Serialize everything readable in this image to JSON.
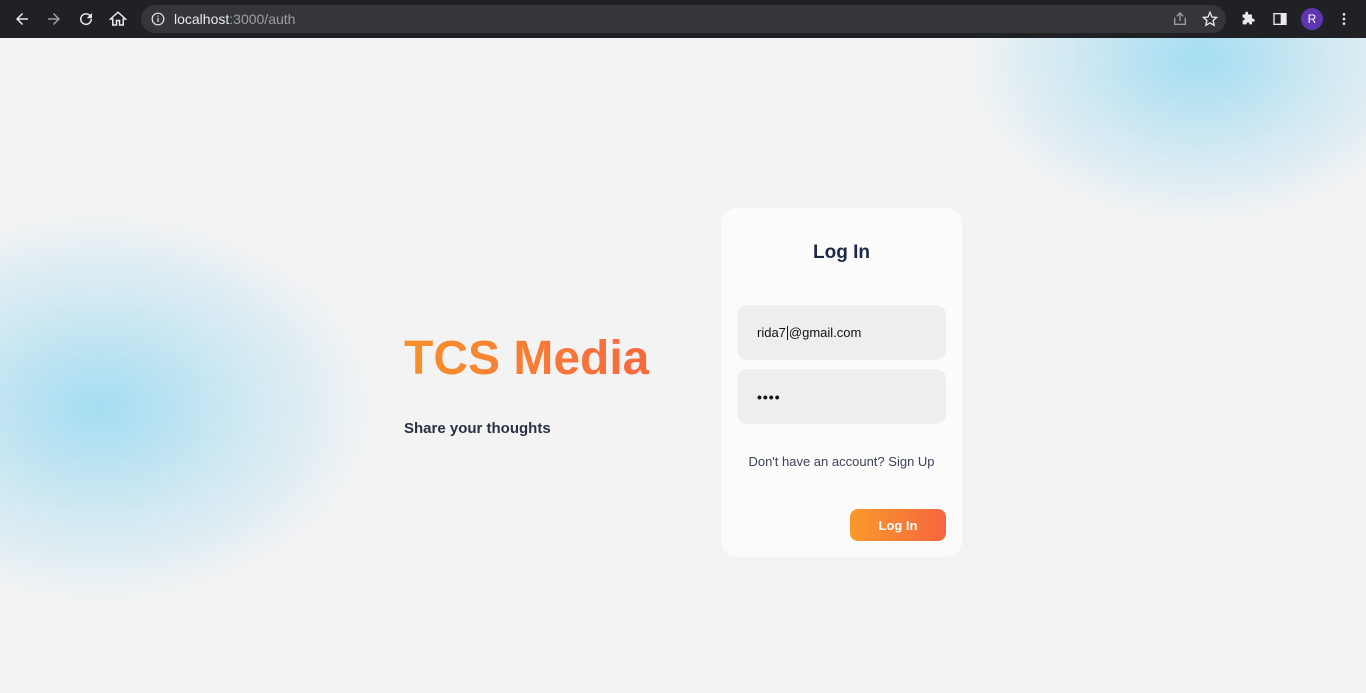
{
  "browser": {
    "url_host": "localhost",
    "url_path": ":3000/auth",
    "profile_initial": "R"
  },
  "page": {
    "brand": "TCS Media",
    "tagline": "Share your thoughts"
  },
  "login": {
    "title": "Log In",
    "email_value_before_caret": "rida7",
    "email_value_after_caret": "@gmail.com",
    "password_value": "••••",
    "signup_prompt": "Don't have an account?",
    "signup_link": "Sign Up",
    "submit_label": "Log In"
  },
  "colors": {
    "brand_gradient_start": "#f7922b",
    "brand_gradient_end": "#f7683f",
    "blob": "#a0dcf2"
  }
}
